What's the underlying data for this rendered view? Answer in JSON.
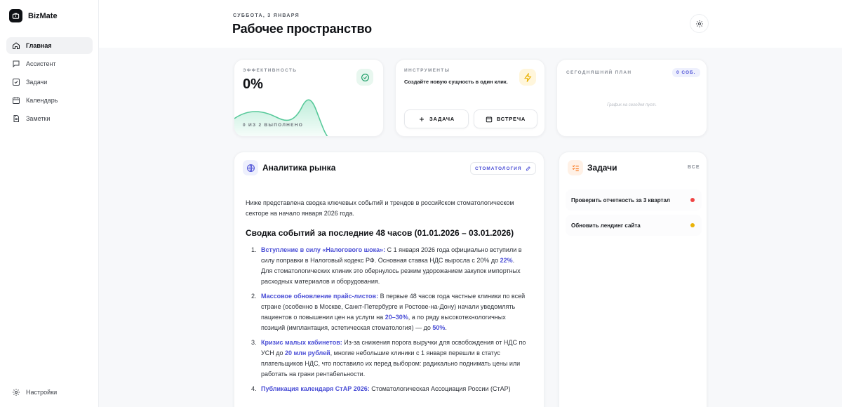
{
  "app": {
    "name": "BizMate"
  },
  "sidebar": {
    "items": [
      {
        "label": "Главная",
        "icon": "home-icon",
        "active": true
      },
      {
        "label": "Ассистент",
        "icon": "chat-icon",
        "active": false
      },
      {
        "label": "Задачи",
        "icon": "checkbox-icon",
        "active": false
      },
      {
        "label": "Календарь",
        "icon": "calendar-icon",
        "active": false
      },
      {
        "label": "Заметки",
        "icon": "document-icon",
        "active": false
      }
    ],
    "settings_label": "Настройки"
  },
  "header": {
    "date": "СУББОТА, 3 ЯНВАРЯ",
    "title": "Рабочее пространство"
  },
  "efficiency": {
    "label": "ЭФФЕКТИВНОСТЬ",
    "value": "0%",
    "caption": "0 ИЗ 2 ВЫПОЛНЕНО",
    "progress": 0
  },
  "tools": {
    "label": "ИНСТРУМЕНТЫ",
    "subtitle": "Создайте новую сущность в один клик.",
    "task_button": "ЗАДАЧА",
    "meeting_button": "ВСТРЕЧА"
  },
  "plan": {
    "label": "СЕГОДНЯШНИЙ ПЛАН",
    "badge": "0 СОБ.",
    "empty_text": "График на сегодня пуст."
  },
  "analytics": {
    "title": "Аналитика рынка",
    "tag": "СТОМАТОЛОГИЯ",
    "intro": "Ниже представлена сводка ключевых событий и трендов в российском стоматологическом секторе на начало января 2026 года.",
    "heading": "Сводка событий за последние 48 часов (01.01.2026 – 03.01.2026)",
    "items": [
      {
        "title": "Вступление в силу «Налогового шока»:",
        "text1": " С 1 января 2026 года официально вступили в силу поправки в Налоговый кодекс РФ. Основная ставка НДС выросла с 20% до ",
        "highlight1": "22%",
        "text2": ". Для стоматологических клиник это обернулось резким удорожанием закупок импортных расходных материалов и оборудования.",
        "highlight2": "",
        "text3": ""
      },
      {
        "title": "Массовое обновление прайс-листов:",
        "text1": " В первые 48 часов года частные клиники по всей стране (особенно в Москве, Санкт-Петербурге и Ростове-на-Дону) начали уведомлять пациентов о повышении цен на услуги на ",
        "highlight1": "20–30%",
        "text2": ", а по ряду высокотехнологичных позиций (имплантация, эстетическая стоматология) — до ",
        "highlight2": "50%",
        "text3": "."
      },
      {
        "title": "Кризис малых кабинетов:",
        "text1": " Из-за снижения порога выручки для освобождения от НДС по УСН до ",
        "highlight1": "20 млн рублей",
        "text2": ", многие небольшие клиники с 1 января перешли в статус плательщиков НДС, что поставило их перед выбором: радикально поднимать цены или работать на грани рентабельности.",
        "highlight2": "",
        "text3": ""
      },
      {
        "title": "Публикация календаря СтАР 2026:",
        "text1": " Стоматологическая Ассоциация России (СтАР)",
        "highlight1": "",
        "text2": "",
        "highlight2": "",
        "text3": ""
      }
    ]
  },
  "tasks": {
    "title": "Задачи",
    "all_link": "ВСЕ",
    "items": [
      {
        "label": "Проверить отчетность за 3 квартал",
        "priority_color": "#ef4444"
      },
      {
        "label": "Обновить лендинг сайта",
        "priority_color": "#eab308"
      }
    ]
  },
  "colors": {
    "accent": "#4b4fd6",
    "success": "#22a06b",
    "warning": "#eab308",
    "danger": "#ef4444"
  }
}
